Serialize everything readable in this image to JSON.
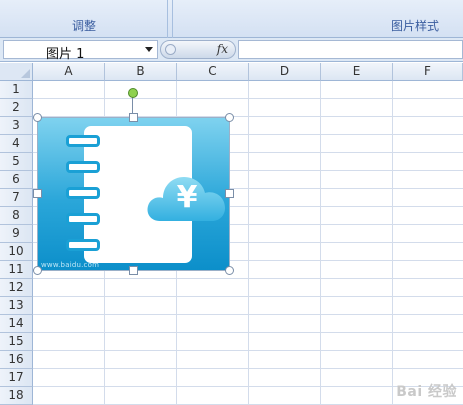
{
  "ribbon": {
    "groups": [
      {
        "label": "调整"
      },
      {
        "label": "图片样式"
      }
    ]
  },
  "formula_bar": {
    "name_box_value": "图片 1",
    "fx_label": "fx",
    "formula_value": ""
  },
  "sheet": {
    "columns": [
      "A",
      "B",
      "C",
      "D",
      "E",
      "F"
    ],
    "rows": [
      "1",
      "2",
      "3",
      "4",
      "5",
      "6",
      "7",
      "8",
      "9",
      "10",
      "11",
      "12",
      "13",
      "14",
      "15",
      "16",
      "17",
      "18"
    ]
  },
  "picture": {
    "symbol": "¥",
    "caption": "www.baidu.com"
  },
  "watermark": "Bai 经验",
  "colors": {
    "accent": "#1aa0d5",
    "rotate_handle": "#8fd14f",
    "header_bg": "#dce6f3"
  }
}
